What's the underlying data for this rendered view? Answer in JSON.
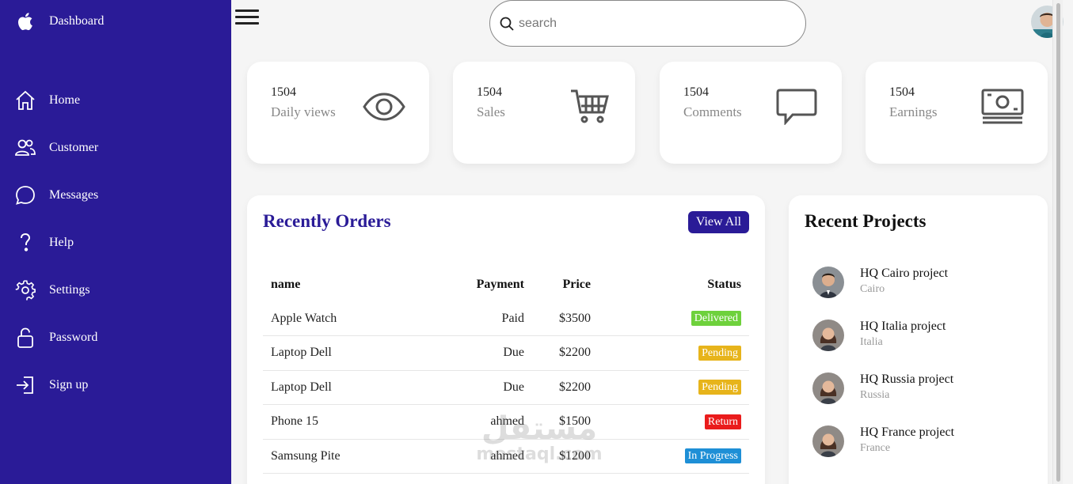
{
  "sidebar": {
    "brand": "Dashboard",
    "items": [
      {
        "label": "Home",
        "icon": "home-icon"
      },
      {
        "label": "Customer",
        "icon": "users-icon"
      },
      {
        "label": "Messages",
        "icon": "chat-icon"
      },
      {
        "label": "Help",
        "icon": "help-icon"
      },
      {
        "label": "Settings",
        "icon": "gear-icon"
      },
      {
        "label": "Password",
        "icon": "lock-icon"
      },
      {
        "label": "Sign up",
        "icon": "sign-in-icon"
      }
    ],
    "color": "#2a1b97"
  },
  "header": {
    "search_placeholder": "search"
  },
  "cards": [
    {
      "value": "1504",
      "caption": "Daily views",
      "icon": "eye-icon"
    },
    {
      "value": "1504",
      "caption": "Sales",
      "icon": "cart-icon"
    },
    {
      "value": "1504",
      "caption": "Comments",
      "icon": "comment-icon"
    },
    {
      "value": "1504",
      "caption": "Earnings",
      "icon": "money-icon"
    }
  ],
  "orders": {
    "title": "Recently Orders",
    "view_all": "View All",
    "columns": [
      "name",
      "Payment",
      "Price",
      "Status"
    ],
    "rows": [
      {
        "name": "Apple Watch",
        "payment": "Paid",
        "price": "$3500",
        "status": "Delivered",
        "status_color": "#6ed13c"
      },
      {
        "name": "Laptop Dell",
        "payment": "Due",
        "price": "$2200",
        "status": "Pending",
        "status_color": "#e7b41b"
      },
      {
        "name": "Laptop Dell",
        "payment": "Due",
        "price": "$2200",
        "status": "Pending",
        "status_color": "#e7b41b"
      },
      {
        "name": "Phone 15",
        "payment": "ahmed",
        "price": "$1500",
        "status": "Return",
        "status_color": "#ea1c1c"
      },
      {
        "name": "Samsung Pite",
        "payment": "ahmed",
        "price": "$1200",
        "status": "In Progress",
        "status_color": "#1e8fd6"
      }
    ]
  },
  "projects": {
    "title": "Recent Projects",
    "items": [
      {
        "name": "HQ Cairo project",
        "city": "Cairo"
      },
      {
        "name": "HQ Italia project",
        "city": "Italia"
      },
      {
        "name": "HQ Russia project",
        "city": "Russia"
      },
      {
        "name": "HQ France project",
        "city": "France"
      }
    ]
  },
  "watermark": {
    "arabic": "مستقل",
    "latin": "mostaql.com"
  }
}
